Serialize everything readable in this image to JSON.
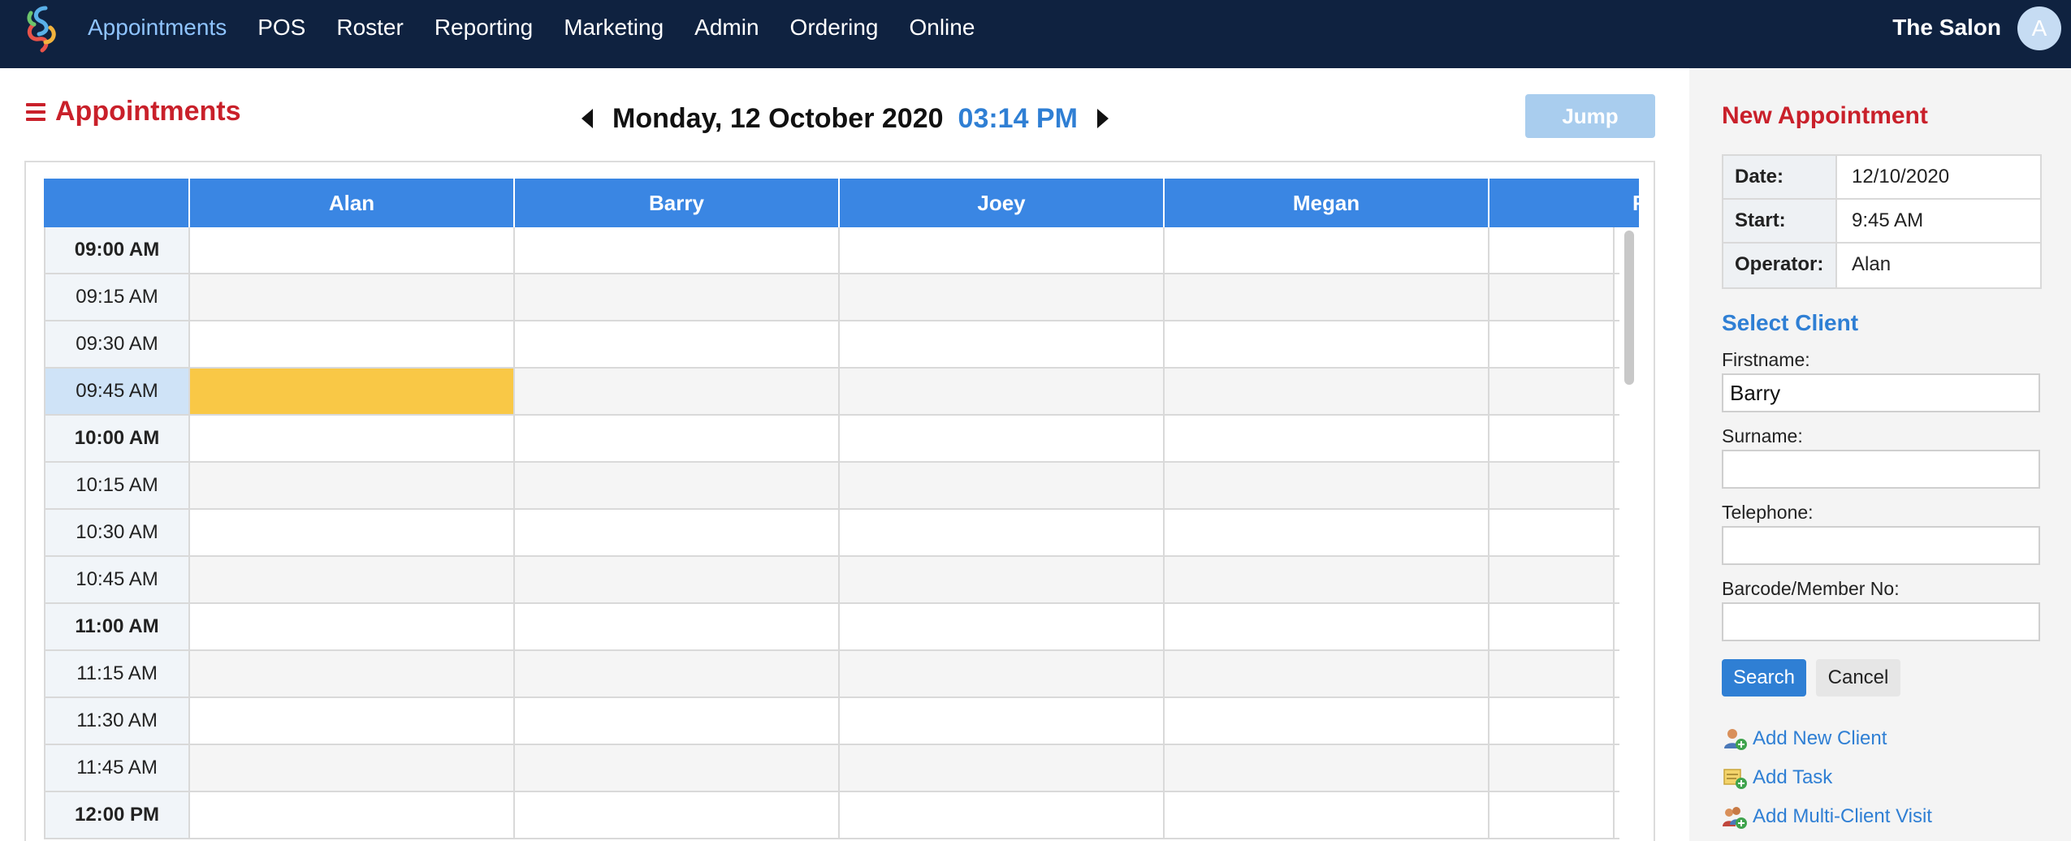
{
  "nav": {
    "items": [
      "Appointments",
      "POS",
      "Roster",
      "Reporting",
      "Marketing",
      "Admin",
      "Ordering",
      "Online"
    ],
    "active": "Appointments",
    "salon_name": "The Salon",
    "avatar_letter": "A"
  },
  "header": {
    "title": "Appointments",
    "date": "Monday, 12 October 2020",
    "time": "03:14 PM",
    "jump_label": "Jump"
  },
  "calendar": {
    "operators": [
      "Alan",
      "Barry",
      "Joey",
      "Megan",
      "R"
    ],
    "times": [
      "09:00 AM",
      "09:15 AM",
      "09:30 AM",
      "09:45 AM",
      "10:00 AM",
      "10:15 AM",
      "10:30 AM",
      "10:45 AM",
      "11:00 AM",
      "11:15 AM",
      "11:30 AM",
      "11:45 AM",
      "12:00 PM"
    ],
    "selected_time": "09:45 AM",
    "selected_operator": "Alan"
  },
  "sidebar": {
    "title": "New Appointment",
    "info": {
      "date_label": "Date:",
      "date_value": "12/10/2020",
      "start_label": "Start:",
      "start_value": "9:45 AM",
      "operator_label": "Operator:",
      "operator_value": "Alan"
    },
    "select_client": "Select Client",
    "firstname_label": "Firstname:",
    "firstname_value": "Barry",
    "surname_label": "Surname:",
    "surname_value": "",
    "telephone_label": "Telephone:",
    "telephone_value": "",
    "barcode_label": "Barcode/Member No:",
    "barcode_value": "",
    "search_label": "Search",
    "cancel_label": "Cancel",
    "links": {
      "add_new_client": "Add New Client",
      "add_task": "Add Task",
      "add_multi_client_visit": "Add Multi-Client Visit"
    }
  },
  "colors": {
    "navbar": "#0f2240",
    "accent_red": "#c9202a",
    "accent_blue": "#2f7fd4",
    "header_blue": "#3a86e3",
    "booked": "#f9c846"
  }
}
